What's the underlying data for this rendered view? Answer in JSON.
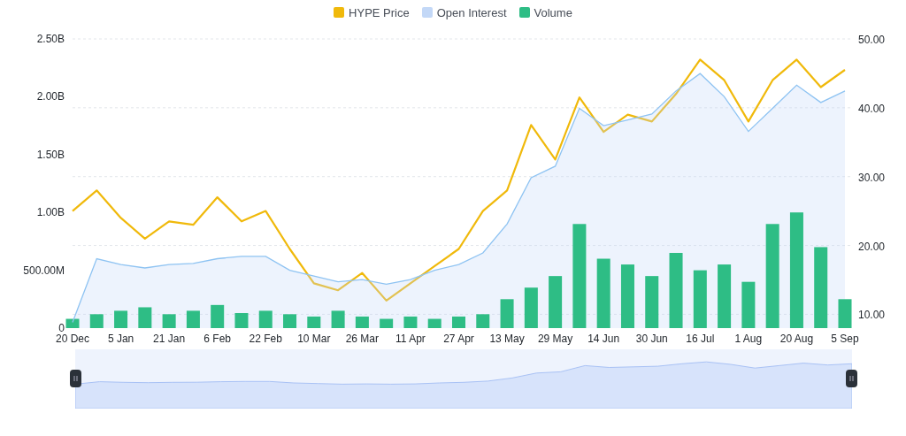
{
  "chart": {
    "chart_data": {
      "type": "line",
      "grid": true,
      "categories": [
        "20 Dec",
        null,
        "5 Jan",
        null,
        "21 Jan",
        null,
        "6 Feb",
        null,
        "22 Feb",
        null,
        "10 Mar",
        null,
        "26 Mar",
        null,
        "11 Apr",
        null,
        "27 Apr",
        null,
        "13 May",
        null,
        "29 May",
        null,
        "14 Jun",
        null,
        "30 Jun",
        null,
        "16 Jul",
        null,
        "1 Aug",
        null,
        "20 Aug",
        null,
        "5 Sep"
      ],
      "ylim": [
        0,
        2500000000
      ],
      "yticks": [
        {
          "value": 0,
          "label": "0"
        },
        {
          "value": 500000000,
          "label": "500.00M"
        },
        {
          "value": 1000000000,
          "label": "1.00B"
        },
        {
          "value": 1500000000,
          "label": "1.50B"
        },
        {
          "value": 2000000000,
          "label": "2.00B"
        },
        {
          "value": 2500000000,
          "label": "2.50B"
        }
      ],
      "y2lim": [
        8,
        50
      ],
      "y2ticks": [
        {
          "value": 10,
          "label": "10.00"
        },
        {
          "value": 20,
          "label": "20.00"
        },
        {
          "value": 30,
          "label": "30.00"
        },
        {
          "value": 40,
          "label": "40.00"
        },
        {
          "value": 50,
          "label": "50.00"
        }
      ],
      "series": [
        {
          "name": "HYPE Price",
          "axis": "y2",
          "color": "#f0b90b",
          "values": [
            25,
            28,
            24,
            21,
            23.5,
            23,
            27,
            23.5,
            25,
            19.5,
            14.5,
            13.5,
            16,
            12,
            14.5,
            17,
            19.5,
            25,
            28,
            37.5,
            32.5,
            41.5,
            36.5,
            39,
            38,
            42,
            47,
            44,
            38,
            44,
            47,
            43,
            45.5
          ]
        },
        {
          "name": "Open Interest",
          "type": "area",
          "color": "#c3d8f7",
          "values": [
            50000000,
            600000000,
            550000000,
            520000000,
            550000000,
            560000000,
            600000000,
            620000000,
            620000000,
            500000000,
            450000000,
            400000000,
            420000000,
            380000000,
            420000000,
            500000000,
            550000000,
            650000000,
            900000000,
            1300000000,
            1400000000,
            1900000000,
            1750000000,
            1800000000,
            1850000000,
            2050000000,
            2200000000,
            2000000000,
            1700000000,
            1900000000,
            2100000000,
            1950000000,
            2050000000
          ]
        },
        {
          "name": "Volume",
          "type": "bar",
          "color": "#2ebd85",
          "values": [
            80000000,
            120000000,
            150000000,
            180000000,
            120000000,
            150000000,
            200000000,
            130000000,
            150000000,
            120000000,
            100000000,
            150000000,
            100000000,
            80000000,
            100000000,
            80000000,
            100000000,
            120000000,
            250000000,
            350000000,
            450000000,
            900000000,
            600000000,
            550000000,
            450000000,
            650000000,
            500000000,
            550000000,
            400000000,
            900000000,
            1000000000,
            700000000,
            250000000
          ]
        }
      ]
    }
  }
}
